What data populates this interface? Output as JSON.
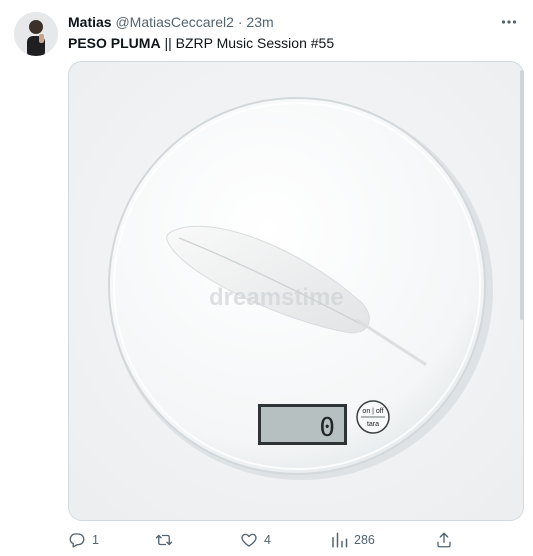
{
  "tweet": {
    "author": {
      "name": "Matias",
      "handle": "@MatiasCeccarel2",
      "separator": "·",
      "time": "23m"
    },
    "text_bold": "PESO PLUMA",
    "text_rest": " || BZRP Music Session #55",
    "media": {
      "scale_display": "0",
      "button_top": "on | off",
      "button_bottom": "tara",
      "watermark": "dreamstime"
    },
    "actions": {
      "reply_count": "1",
      "retweet_count": "",
      "like_count": "4",
      "views_count": "286"
    }
  },
  "icons": [
    "more-icon",
    "reply-icon",
    "retweet-icon",
    "like-icon",
    "views-icon",
    "share-icon"
  ],
  "colors": {
    "text_primary": "#0f1419",
    "text_secondary": "#536471",
    "border": "#cfd9de"
  }
}
